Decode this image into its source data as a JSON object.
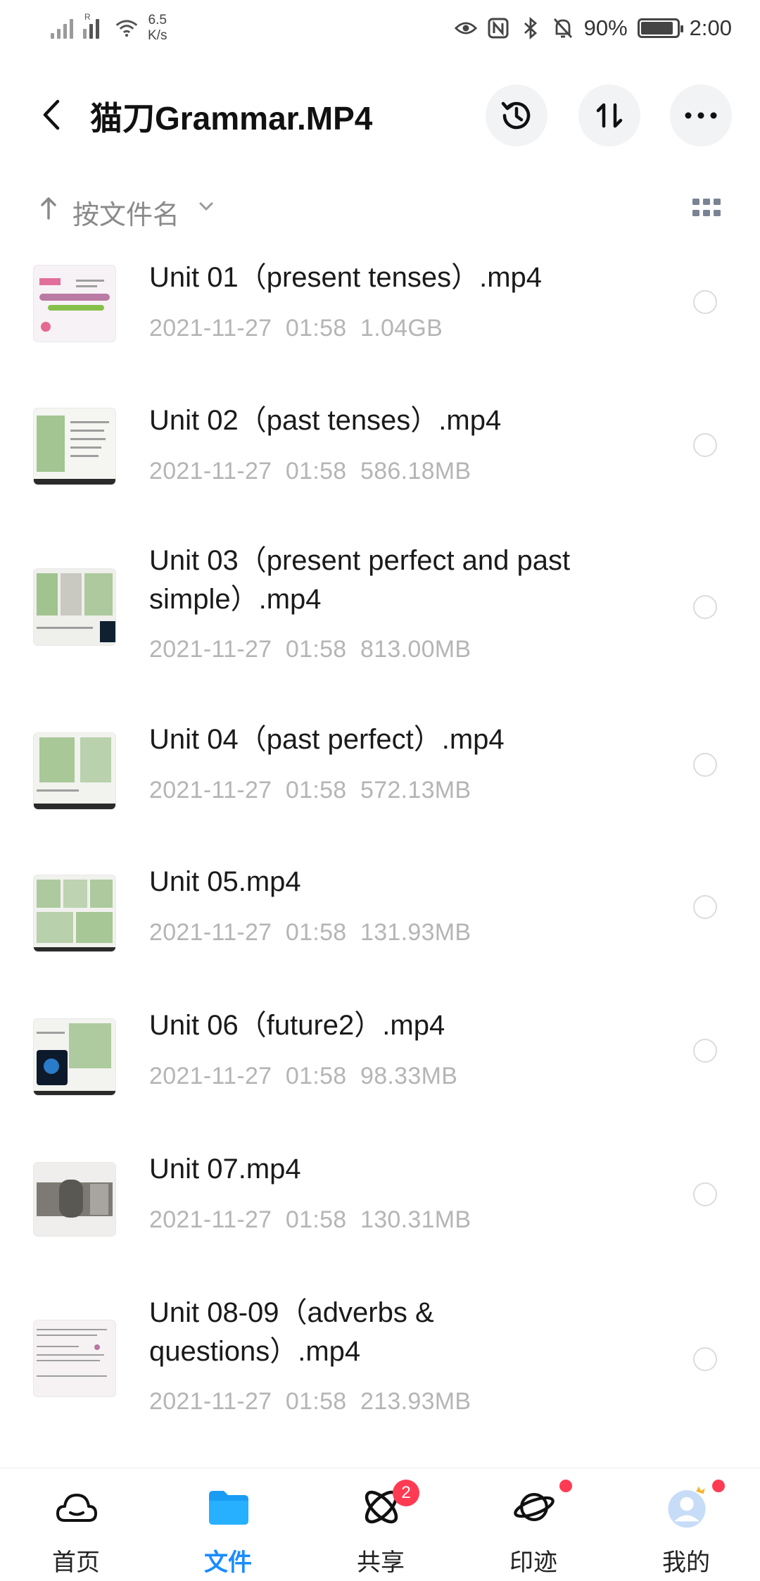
{
  "status_bar": {
    "net_speed": "6.5",
    "net_speed_unit": "K/s",
    "signal_label": "R",
    "battery": "90%",
    "time": "2:00",
    "battery_level": 0.9
  },
  "header": {
    "title": "猫刀Grammar.MP4",
    "icons": [
      "back-icon",
      "history-icon",
      "sort-icon",
      "more-icon"
    ]
  },
  "sort": {
    "label": "按文件名"
  },
  "files": [
    {
      "name": "Unit 01（present tenses）.mp4",
      "date": "2021-11-27",
      "time": "01:58",
      "size": "1.04GB"
    },
    {
      "name": "Unit 02（past tenses）.mp4",
      "date": "2021-11-27",
      "time": "01:58",
      "size": "586.18MB"
    },
    {
      "name": "Unit 03（present perfect and past simple）.mp4",
      "date": "2021-11-27",
      "time": "01:58",
      "size": "813.00MB"
    },
    {
      "name": "Unit 04（past perfect）.mp4",
      "date": "2021-11-27",
      "time": "01:58",
      "size": "572.13MB"
    },
    {
      "name": "Unit 05.mp4",
      "date": "2021-11-27",
      "time": "01:58",
      "size": "131.93MB"
    },
    {
      "name": "Unit 06（future2）.mp4",
      "date": "2021-11-27",
      "time": "01:58",
      "size": "98.33MB"
    },
    {
      "name": "Unit 07.mp4",
      "date": "2021-11-27",
      "time": "01:58",
      "size": "130.31MB"
    },
    {
      "name": "Unit 08-09（adverbs & questions）.mp4",
      "date": "2021-11-27",
      "time": "01:58",
      "size": "213.93MB"
    }
  ],
  "bottom_nav": {
    "items": [
      {
        "label": "首页",
        "icon": "cloud-icon"
      },
      {
        "label": "文件",
        "icon": "folder-icon",
        "active": true
      },
      {
        "label": "共享",
        "icon": "share-atom-icon",
        "badge": "2"
      },
      {
        "label": "印迹",
        "icon": "planet-icon",
        "dot": true
      },
      {
        "label": "我的",
        "icon": "avatar-icon",
        "dot": true
      }
    ]
  },
  "colors": {
    "accent": "#1a8cff",
    "badge": "#ff3b53",
    "meta_text": "#b5b5b5"
  }
}
